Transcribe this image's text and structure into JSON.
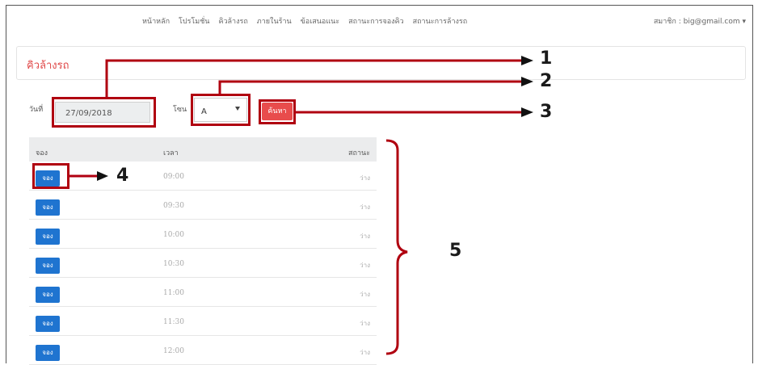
{
  "nav": {
    "links": [
      "หน้าหลัก",
      "โปรโมชั่น",
      "คิวล้างรถ",
      "ภายในร้าน",
      "ข้อเสนอแนะ",
      "สถานะการจองคิว",
      "สถานะการล้างรถ"
    ],
    "user_menu": "สมาชิก : big@gmail.com ▾"
  },
  "page": {
    "title": "คิวล้างรถ"
  },
  "form": {
    "date_label": "วันที่",
    "date_value": "27/09/2018",
    "zone_label": "โซน",
    "zone_value": "A",
    "search_label": "ค้นหา"
  },
  "table": {
    "headers": {
      "book": "จอง",
      "time": "เวลา",
      "status": "สถานะ"
    },
    "rows": [
      {
        "button": "จอง",
        "time": "09:00",
        "status": "ว่าง"
      },
      {
        "button": "จอง",
        "time": "09:30",
        "status": "ว่าง"
      },
      {
        "button": "จอง",
        "time": "10:00",
        "status": "ว่าง"
      },
      {
        "button": "จอง",
        "time": "10:30",
        "status": "ว่าง"
      },
      {
        "button": "จอง",
        "time": "11:00",
        "status": "ว่าง"
      },
      {
        "button": "จอง",
        "time": "11:30",
        "status": "ว่าง"
      },
      {
        "button": "จอง",
        "time": "12:00",
        "status": "ว่าง"
      }
    ]
  },
  "callouts": [
    "1",
    "2",
    "3",
    "4",
    "5"
  ],
  "colors": {
    "annotation": "#b00010",
    "accent": "#e84c4c",
    "button": "#1f74d0"
  }
}
